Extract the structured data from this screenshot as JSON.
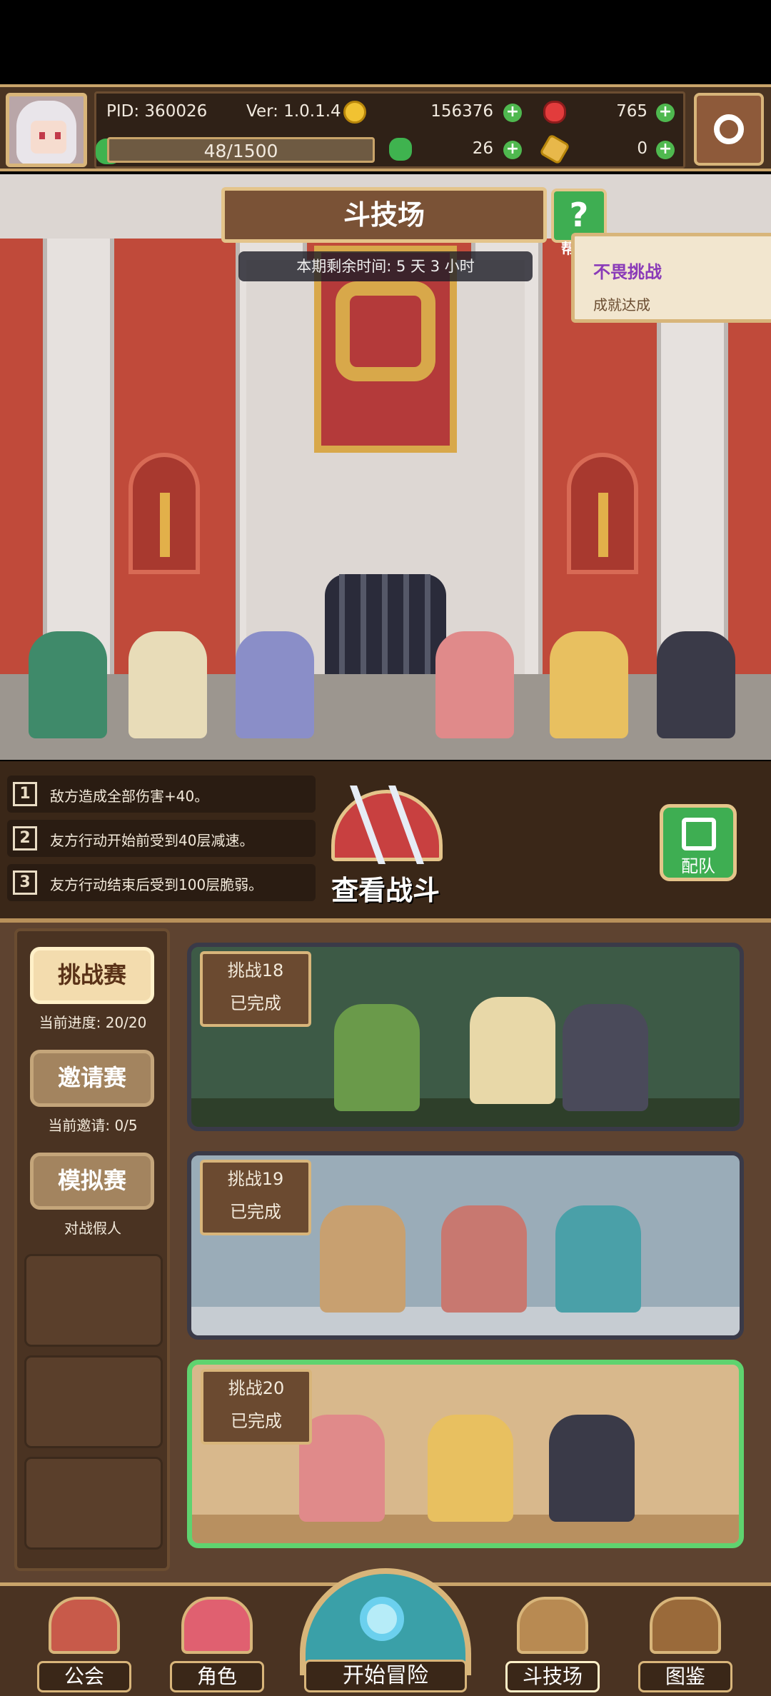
{
  "header": {
    "pid": "PID: 360026",
    "version": "Ver: 1.0.1.4",
    "coins": "156376",
    "gems": "765",
    "stamina": "48/1500",
    "clovers": "26",
    "keys": "0"
  },
  "arena": {
    "title": "斗技场",
    "help_label": "帮",
    "timer": "本期剩余时间: 5 天 3 小时"
  },
  "achievement": {
    "name": "不畏挑战",
    "status": "成就达成"
  },
  "effects": [
    {
      "num": "1",
      "text": "敌方造成全部伤害+40。"
    },
    {
      "num": "2",
      "text": "友方行动开始前受到40层减速。"
    },
    {
      "num": "3",
      "text": "友方行动结束后受到100层脆弱。"
    }
  ],
  "battle": {
    "view_label": "查看战斗",
    "team_label": "配队"
  },
  "modes": [
    {
      "label": "挑战赛",
      "sub": "当前进度: 20/20",
      "active": true
    },
    {
      "label": "邀请赛",
      "sub": "当前邀请: 0/5",
      "active": false
    },
    {
      "label": "模拟赛",
      "sub": "对战假人",
      "active": false
    }
  ],
  "challenges": [
    {
      "title": "挑战18",
      "status": "已完成"
    },
    {
      "title": "挑战19",
      "status": "已完成"
    },
    {
      "title": "挑战20",
      "status": "已完成"
    }
  ],
  "nav": {
    "guild": "公会",
    "characters": "角色",
    "start": "开始冒险",
    "arena": "斗技场",
    "codex": "图鉴"
  }
}
